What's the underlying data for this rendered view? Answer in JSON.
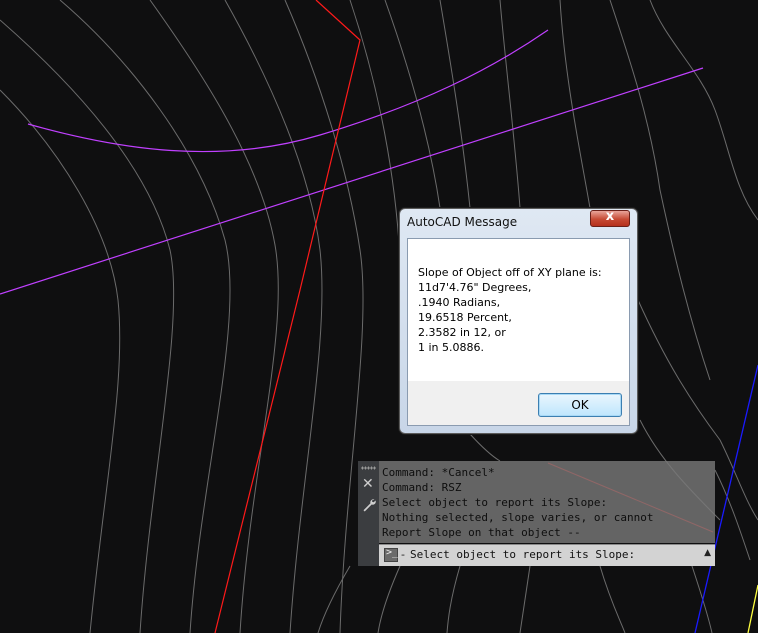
{
  "dialog": {
    "title": "AutoCAD Message",
    "close_label": "x",
    "lines": [
      "Slope of Object off of XY plane is:",
      "11d7'4.76\" Degrees,",
      ".1940 Radians,",
      "19.6518 Percent,",
      "2.3582 in 12, or",
      "1 in 5.0886."
    ],
    "ok_label": "OK"
  },
  "command_line": {
    "close_icon": "close-icon",
    "settings_icon": "wrench-icon",
    "history": [
      "Command: *Cancel*",
      "Command: RSZ",
      "Select object to report its Slope:",
      "Nothing selected, slope varies, or cannot",
      "Report Slope on that object --"
    ],
    "prompt_icon_glyph": ">_",
    "prompt_dash": "-",
    "prompt": "Select object to report its Slope:",
    "recent_arrow": "▲"
  },
  "colors": {
    "background": "#0f0f10",
    "contour": "#8a8a8a",
    "red_line": "#ff1a1a",
    "magenta_line": "#c040ff",
    "blue_line": "#1a1aff",
    "yellow_line": "#ffff40"
  }
}
